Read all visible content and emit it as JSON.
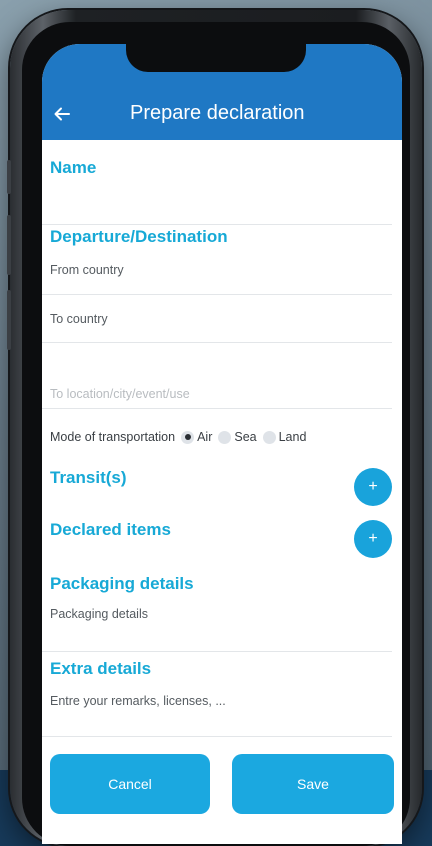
{
  "app_bar": {
    "title": "Prepare declaration",
    "back_icon": "arrow-left-icon"
  },
  "sections": {
    "name": "Name",
    "departure_destination": "Departure/Destination",
    "transits": "Transit(s)",
    "declared_items": "Declared items",
    "packaging_details": "Packaging details",
    "extra_details": "Extra details"
  },
  "fields": {
    "from_country": "From country",
    "to_country": "To country",
    "to_location_placeholder": "To location/city/event/use",
    "packaging_details": "Packaging details",
    "extra_details_placeholder": "Entre your remarks, licenses, ..."
  },
  "transport": {
    "label": "Mode of transportation",
    "options": [
      "Air",
      "Sea",
      "Land"
    ],
    "selected": "Air"
  },
  "actions": {
    "add_transit_icon": "plus-icon",
    "add_item_icon": "plus-icon",
    "cancel": "Cancel",
    "save": "Save"
  },
  "colors": {
    "app_bar": "#1f78c4",
    "section_title": "#17a9d6",
    "button": "#1ba8e0"
  }
}
